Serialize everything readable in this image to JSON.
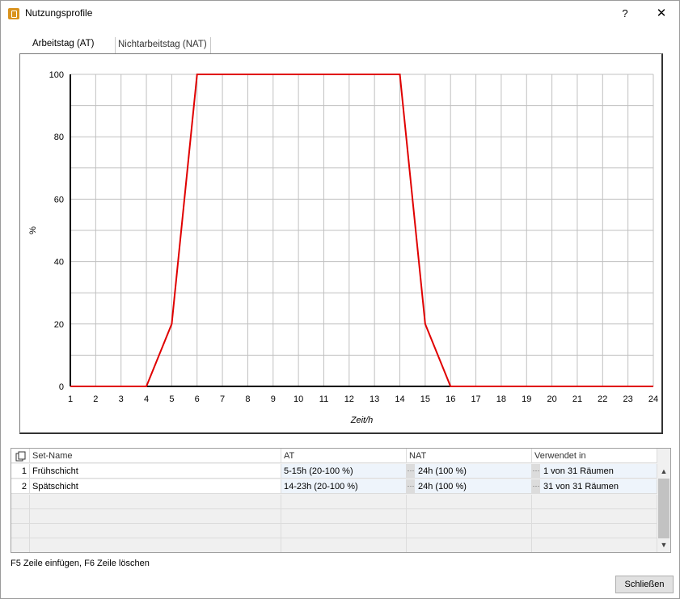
{
  "window": {
    "title": "Nutzungsprofile",
    "help": "?",
    "close": "✕"
  },
  "tabs": [
    {
      "label": "Arbeitstag (AT)",
      "active": true
    },
    {
      "label": "Nichtarbeitstag (NAT)",
      "active": false
    }
  ],
  "chart_data": {
    "type": "line",
    "title": "",
    "xlabel": "Zeit/h",
    "ylabel": "%",
    "xlim": [
      1,
      24
    ],
    "ylim": [
      0,
      100
    ],
    "x_ticks": [
      1,
      2,
      3,
      4,
      5,
      6,
      7,
      8,
      9,
      10,
      11,
      12,
      13,
      14,
      15,
      16,
      17,
      18,
      19,
      20,
      21,
      22,
      23,
      24
    ],
    "y_ticks": [
      0,
      20,
      40,
      60,
      80,
      100
    ],
    "grid": true,
    "series": [
      {
        "color": "#e00000",
        "x": [
          1,
          2,
          3,
          4,
          5,
          6,
          7,
          8,
          9,
          10,
          11,
          12,
          13,
          14,
          15,
          16,
          17,
          18,
          19,
          20,
          21,
          22,
          23,
          24
        ],
        "y": [
          0,
          0,
          0,
          0,
          20,
          100,
          100,
          100,
          100,
          100,
          100,
          100,
          100,
          100,
          20,
          0,
          0,
          0,
          0,
          0,
          0,
          0,
          0,
          0
        ]
      }
    ]
  },
  "table": {
    "columns": [
      "Set-Name",
      "AT",
      "NAT",
      "Verwendet in"
    ],
    "rows": [
      {
        "num": "1",
        "name": "Frühschicht",
        "at": "5-15h (20-100 %)",
        "nat": "24h (100 %)",
        "used": "1 von 31 Räumen"
      },
      {
        "num": "2",
        "name": "Spätschicht",
        "at": "14-23h (20-100 %)",
        "nat": "24h (100 %)",
        "used": "31 von 31 Räumen"
      }
    ],
    "dots": "···"
  },
  "status": "F5 Zeile einfügen, F6 Zeile löschen",
  "buttons": {
    "close": "Schließen"
  },
  "colors": {
    "series": "#e00000",
    "grid": "#c0c0c0",
    "axis": "#000000"
  }
}
